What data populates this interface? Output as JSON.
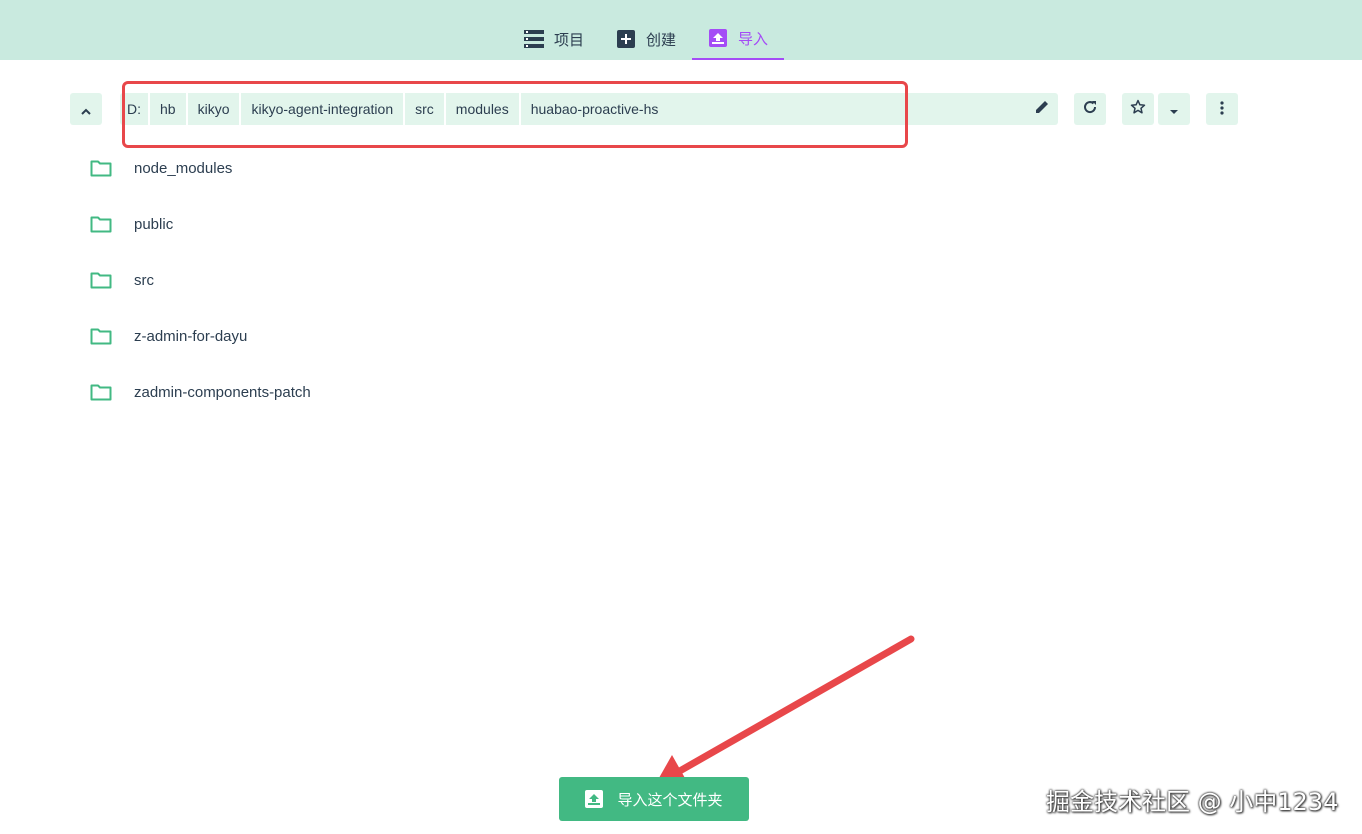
{
  "tabs": [
    {
      "label": "项目",
      "icon": "list-icon",
      "active": false
    },
    {
      "label": "创建",
      "icon": "plus-box-icon",
      "active": false
    },
    {
      "label": "导入",
      "icon": "import-icon",
      "active": true
    }
  ],
  "path": {
    "segments": [
      "D:",
      "hb",
      "kikyo",
      "kikyo-agent-integration",
      "src",
      "modules",
      "huabao-proactive-hs"
    ]
  },
  "toolbar": {
    "up_icon": "chevron-up-icon",
    "edit_icon": "pencil-icon",
    "refresh_icon": "refresh-icon",
    "favorite_icon": "star-outline-icon",
    "favorites_menu_icon": "caret-down-icon",
    "more_icon": "dots-vertical-icon"
  },
  "folders": [
    {
      "name": "node_modules"
    },
    {
      "name": "public"
    },
    {
      "name": "src"
    },
    {
      "name": "z-admin-for-dayu"
    },
    {
      "name": "zadmin-components-patch"
    }
  ],
  "import_button": {
    "label": "导入这个文件夹",
    "icon": "import-icon"
  },
  "watermark": "掘金技术社区 @ 小中1234",
  "colors": {
    "accent_green": "#42b983",
    "active_tab": "#a44cf6",
    "topbar_bg": "#c9eadf",
    "annotation_red": "#e8474a"
  }
}
